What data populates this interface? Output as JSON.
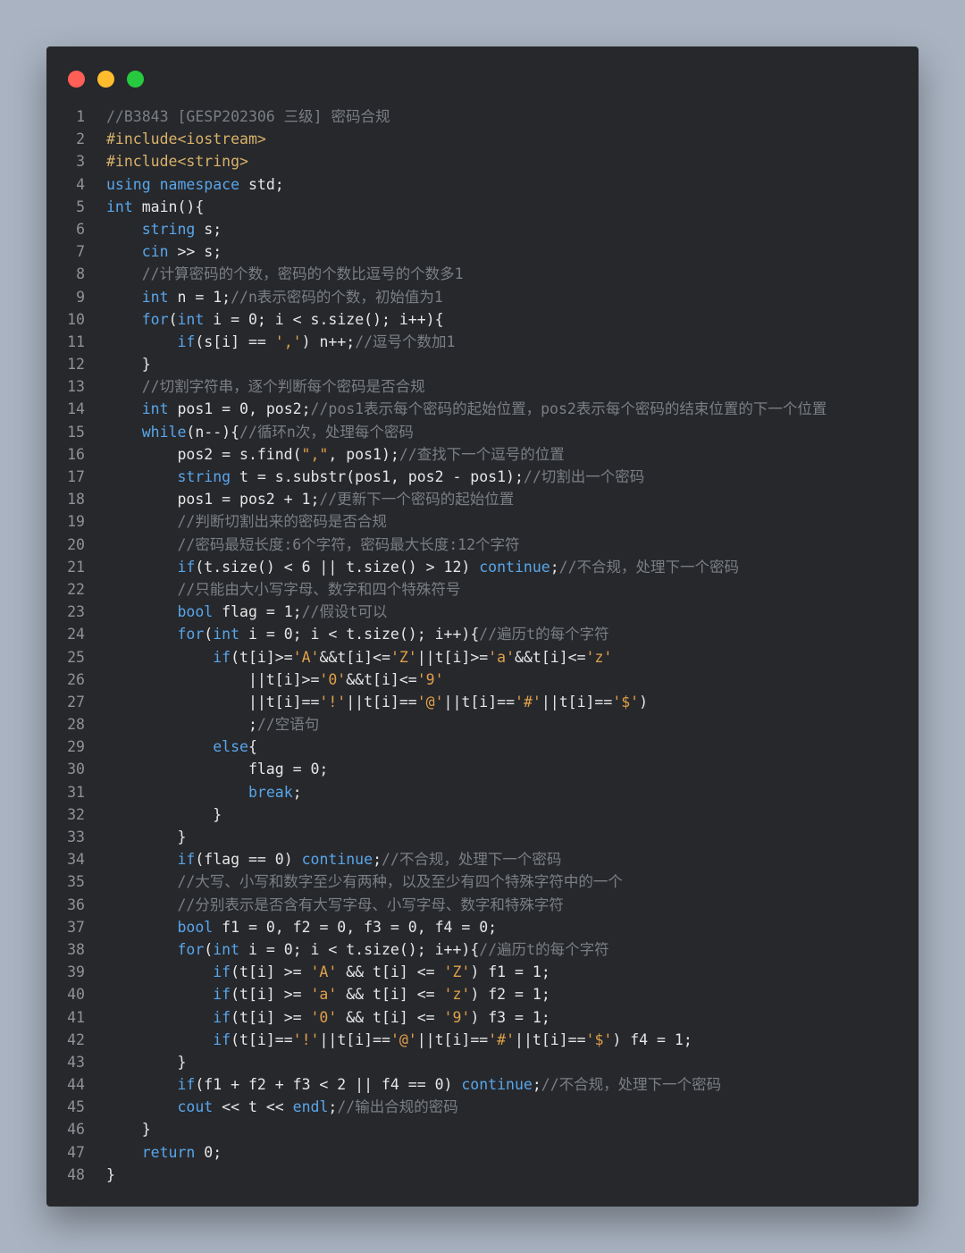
{
  "window": {
    "controls": [
      {
        "name": "close",
        "color": "#ff5f56"
      },
      {
        "name": "minimize",
        "color": "#ffbd2e"
      },
      {
        "name": "zoom",
        "color": "#27c93f"
      }
    ]
  },
  "code": {
    "lines": [
      {
        "n": "1",
        "t": "//B3843 [GESP202306 三级] 密码合规"
      },
      {
        "n": "2",
        "t": "#include<iostream>"
      },
      {
        "n": "3",
        "t": "#include<string>"
      },
      {
        "n": "4",
        "t": "using namespace std;"
      },
      {
        "n": "5",
        "t": "int main(){"
      },
      {
        "n": "6",
        "t": "    string s;"
      },
      {
        "n": "7",
        "t": "    cin >> s;"
      },
      {
        "n": "8",
        "t": "    //计算密码的个数，密码的个数比逗号的个数多1"
      },
      {
        "n": "9",
        "t": "    int n = 1;//n表示密码的个数，初始值为1"
      },
      {
        "n": "10",
        "t": "    for(int i = 0; i < s.size(); i++){"
      },
      {
        "n": "11",
        "t": "        if(s[i] == ',') n++;//逗号个数加1"
      },
      {
        "n": "12",
        "t": "    }"
      },
      {
        "n": "13",
        "t": "    //切割字符串，逐个判断每个密码是否合规"
      },
      {
        "n": "14",
        "t": "    int pos1 = 0, pos2;//pos1表示每个密码的起始位置，pos2表示每个密码的结束位置的下一个位置"
      },
      {
        "n": "15",
        "t": "    while(n--){//循环n次，处理每个密码"
      },
      {
        "n": "16",
        "t": "        pos2 = s.find(\",\", pos1);//查找下一个逗号的位置"
      },
      {
        "n": "17",
        "t": "        string t = s.substr(pos1, pos2 - pos1);//切割出一个密码"
      },
      {
        "n": "18",
        "t": "        pos1 = pos2 + 1;//更新下一个密码的起始位置"
      },
      {
        "n": "19",
        "t": "        //判断切割出来的密码是否合规"
      },
      {
        "n": "20",
        "t": "        //密码最短长度:6个字符，密码最大长度:12个字符"
      },
      {
        "n": "21",
        "t": "        if(t.size() < 6 || t.size() > 12) continue;//不合规，处理下一个密码"
      },
      {
        "n": "22",
        "t": "        //只能由大小写字母、数字和四个特殊符号"
      },
      {
        "n": "23",
        "t": "        bool flag = 1;//假设t可以"
      },
      {
        "n": "24",
        "t": "        for(int i = 0; i < t.size(); i++){//遍历t的每个字符"
      },
      {
        "n": "25",
        "t": "            if(t[i]>='A'&&t[i]<='Z'||t[i]>='a'&&t[i]<='z'"
      },
      {
        "n": "26",
        "t": "                ||t[i]>='0'&&t[i]<='9'"
      },
      {
        "n": "27",
        "t": "                ||t[i]=='!'||t[i]=='@'||t[i]=='#'||t[i]=='$')"
      },
      {
        "n": "28",
        "t": "                ;//空语句"
      },
      {
        "n": "29",
        "t": "            else{"
      },
      {
        "n": "30",
        "t": "                flag = 0;"
      },
      {
        "n": "31",
        "t": "                break;"
      },
      {
        "n": "32",
        "t": "            }"
      },
      {
        "n": "33",
        "t": "        }"
      },
      {
        "n": "34",
        "t": "        if(flag == 0) continue;//不合规，处理下一个密码"
      },
      {
        "n": "35",
        "t": "        //大写、小写和数字至少有两种，以及至少有四个特殊字符中的一个"
      },
      {
        "n": "36",
        "t": "        //分别表示是否含有大写字母、小写字母、数字和特殊字符"
      },
      {
        "n": "37",
        "t": "        bool f1 = 0, f2 = 0, f3 = 0, f4 = 0;"
      },
      {
        "n": "38",
        "t": "        for(int i = 0; i < t.size(); i++){//遍历t的每个字符"
      },
      {
        "n": "39",
        "t": "            if(t[i] >= 'A' && t[i] <= 'Z') f1 = 1;"
      },
      {
        "n": "40",
        "t": "            if(t[i] >= 'a' && t[i] <= 'z') f2 = 1;"
      },
      {
        "n": "41",
        "t": "            if(t[i] >= '0' && t[i] <= '9') f3 = 1;"
      },
      {
        "n": "42",
        "t": "            if(t[i]=='!'||t[i]=='@'||t[i]=='#'||t[i]=='$') f4 = 1;"
      },
      {
        "n": "43",
        "t": "        }"
      },
      {
        "n": "44",
        "t": "        if(f1 + f2 + f3 < 2 || f4 == 0) continue;//不合规，处理下一个密码"
      },
      {
        "n": "45",
        "t": "        cout << t << endl;//输出合规的密码"
      },
      {
        "n": "46",
        "t": "    }"
      },
      {
        "n": "47",
        "t": "    return 0;"
      },
      {
        "n": "48",
        "t": "}"
      }
    ]
  }
}
